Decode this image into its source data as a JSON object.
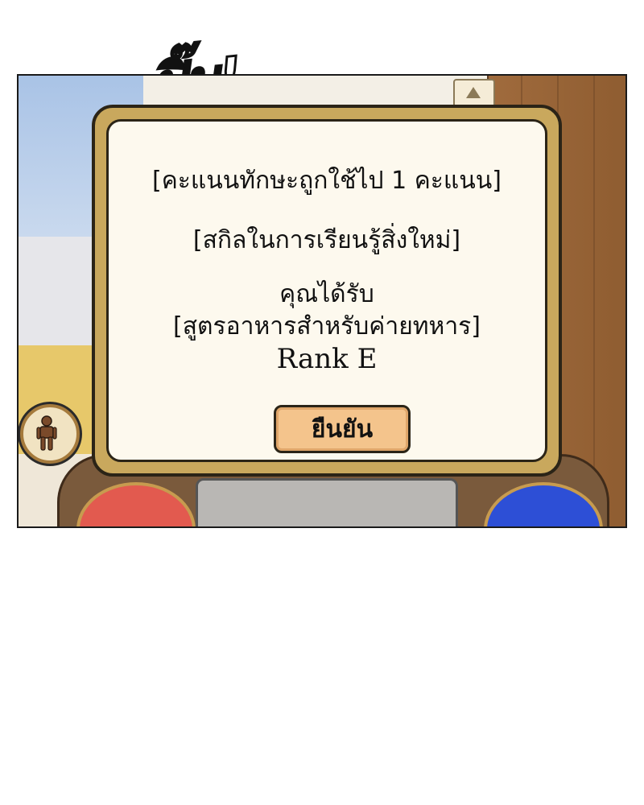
{
  "sfx": {
    "text": "ปิ๊บ!"
  },
  "dialog": {
    "line1": "[คะแนนทักษะถูกใช้ไป 1 คะแนน]",
    "line2": "[สกิลในการเรียนรู้สิ่งใหม่]",
    "line3a": "คุณได้รับ",
    "line3b": "[สูตรอาหารสำหรับค่ายทหาร]",
    "line3c": "Rank E",
    "confirm_label": "ยืนยัน"
  },
  "colors": {
    "dialog_frame": "#c9a85d",
    "dialog_fill": "#fdf9ee",
    "confirm_button": "#f4c48c",
    "red_button": "#e25a4f",
    "blue_button": "#2d4fd6"
  },
  "icons": {
    "avatar": "person-icon",
    "scroll": "chevron-up-icon"
  }
}
